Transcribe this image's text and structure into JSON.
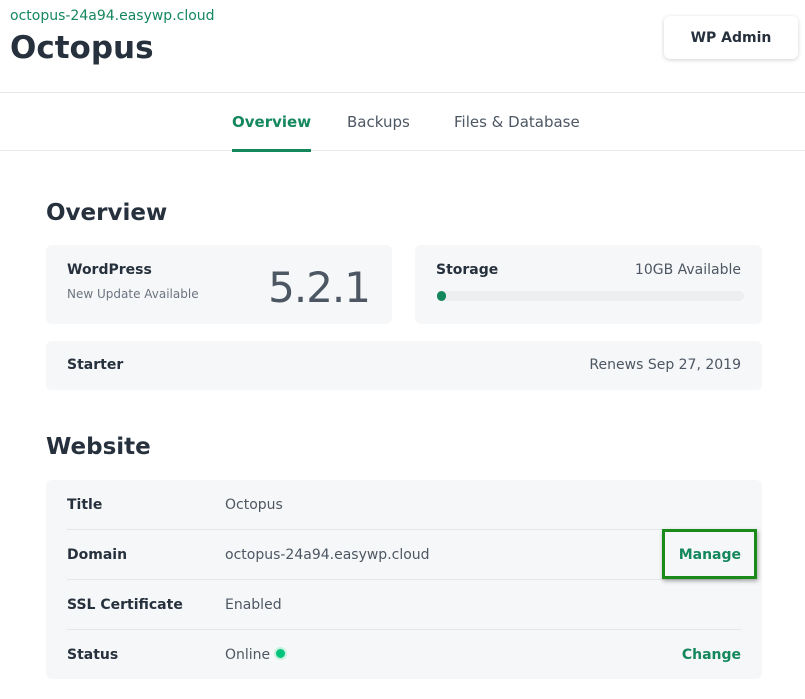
{
  "header": {
    "subdomain": "octopus-24a94.easywp.cloud",
    "title": "Octopus",
    "wp_admin_label": "WP Admin"
  },
  "tabs": [
    {
      "label": "Overview",
      "active": true
    },
    {
      "label": "Backups",
      "active": false
    },
    {
      "label": "Files & Database",
      "active": false
    }
  ],
  "overview": {
    "title": "Overview",
    "wordpress": {
      "label": "WordPress",
      "update_text": "New Update Available",
      "version": "5.2.1"
    },
    "storage": {
      "label": "Storage",
      "available": "10GB Available",
      "used_fraction": 0.01
    },
    "plan": {
      "name": "Starter",
      "renews": "Renews Sep 27, 2019"
    }
  },
  "website": {
    "title": "Website",
    "rows": [
      {
        "label": "Title",
        "value": "Octopus",
        "action": ""
      },
      {
        "label": "Domain",
        "value": "octopus-24a94.easywp.cloud",
        "action": "Manage"
      },
      {
        "label": "SSL Certificate",
        "value": "Enabled",
        "action": ""
      },
      {
        "label": "Status",
        "value": "Online",
        "action": "Change"
      }
    ]
  },
  "colors": {
    "accent": "#14875d",
    "status_online": "#00c47c",
    "highlight_box": "#1a8a1a"
  }
}
